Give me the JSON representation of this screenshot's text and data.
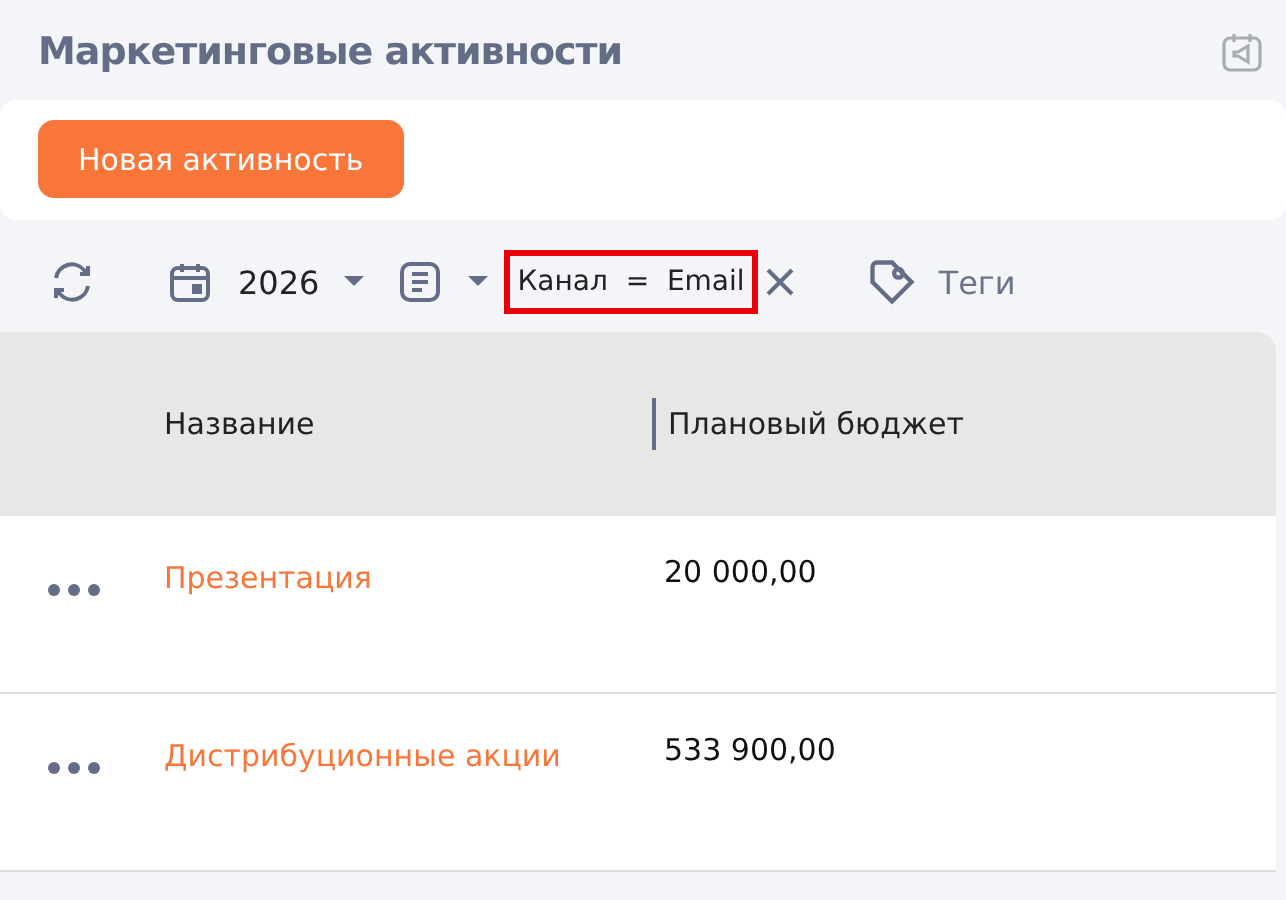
{
  "page": {
    "title": "Маркетинговые активности"
  },
  "actions": {
    "new_button": "Новая активность"
  },
  "toolbar": {
    "year": "2026",
    "filter": {
      "text": "Канал  =  Email",
      "highlighted": true
    },
    "tags": "Теги"
  },
  "table": {
    "columns": [
      "Название",
      "Плановый бюджет"
    ],
    "rows": [
      {
        "name": "Презентация",
        "budget": "20 000,00"
      },
      {
        "name": "Дистрибуционные акции",
        "budget": "533 900,00"
      }
    ]
  }
}
